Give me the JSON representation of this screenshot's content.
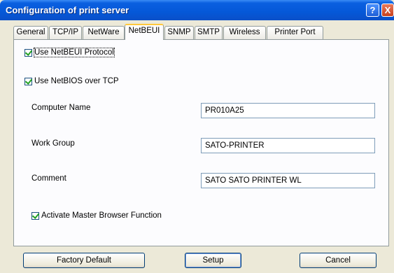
{
  "window": {
    "title": "Configuration of print server",
    "help_label": "?",
    "close_label": "X"
  },
  "tabs": [
    {
      "label": "General"
    },
    {
      "label": "TCP/IP"
    },
    {
      "label": "NetWare"
    },
    {
      "label": "NetBEUI",
      "active": true
    },
    {
      "label": "SNMP"
    },
    {
      "label": "SMTP"
    },
    {
      "label": "Wireless"
    },
    {
      "label": "Printer Port"
    }
  ],
  "netbeui": {
    "use_netbeui": {
      "label": "Use NetBEUI Protocol",
      "checked": true
    },
    "use_netbios": {
      "label": "Use NetBIOS over TCP",
      "checked": true
    },
    "computer_name": {
      "label": "Computer Name",
      "value": "PR010A25"
    },
    "work_group": {
      "label": "Work Group",
      "value": "SATO-PRINTER"
    },
    "comment": {
      "label": "Comment",
      "value": "SATO SATO PRINTER WL"
    },
    "master_browser": {
      "label": "Activate Master Browser Function",
      "checked": true
    }
  },
  "buttons": {
    "factory_default": "Factory Default",
    "setup": "Setup",
    "cancel": "Cancel"
  }
}
